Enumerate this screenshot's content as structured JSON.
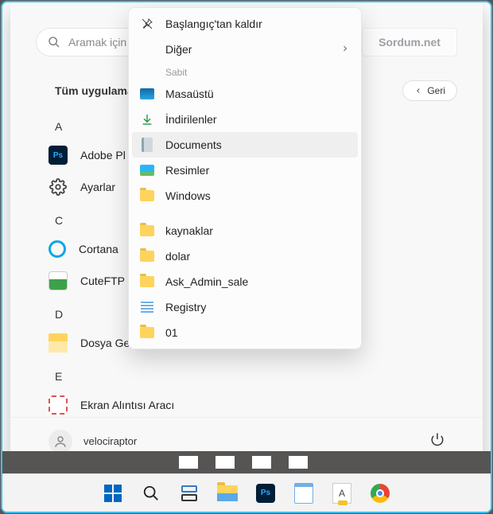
{
  "search": {
    "placeholder": "Aramak için b"
  },
  "sordum_btn": "Sordum.net",
  "all_apps_title": "Tüm uygulama",
  "back_btn": "Geri",
  "letters": [
    "A",
    "C",
    "D",
    "E"
  ],
  "apps": {
    "a": [
      {
        "label": "Adobe Pl",
        "icon": "ps"
      },
      {
        "label": "Ayarlar",
        "icon": "settings"
      }
    ],
    "c": [
      {
        "label": "Cortana",
        "icon": "cortana"
      },
      {
        "label": "CuteFTP !",
        "icon": "cuteftp"
      }
    ],
    "d": [
      {
        "label": "Dosya Gezgini",
        "icon": "explorer"
      }
    ],
    "e": [
      {
        "label": "Ekran Alıntısı Aracı",
        "icon": "snip"
      }
    ]
  },
  "user": {
    "name": "velociraptor"
  },
  "context_menu": {
    "unpin": "Başlangıç'tan kaldır",
    "more": "Diğer",
    "pinned_header": "Sabit",
    "pinned": [
      {
        "label": "Masaüstü",
        "icon": "desktop"
      },
      {
        "label": "İndirilenler",
        "icon": "download"
      },
      {
        "label": "Documents",
        "icon": "doc",
        "highlighted": true
      },
      {
        "label": "Resimler",
        "icon": "pic"
      },
      {
        "label": "Windows",
        "icon": "folder"
      }
    ],
    "extra": [
      {
        "label": "kaynaklar",
        "icon": "folder"
      },
      {
        "label": "dolar",
        "icon": "folder"
      },
      {
        "label": "Ask_Admin_sale",
        "icon": "folder"
      },
      {
        "label": "Registry",
        "icon": "reg"
      },
      {
        "label": "01",
        "icon": "folder"
      }
    ]
  },
  "taskbar": [
    "start",
    "search",
    "taskview",
    "explorer",
    "ps",
    "notepad",
    "fontcreator",
    "chrome"
  ]
}
